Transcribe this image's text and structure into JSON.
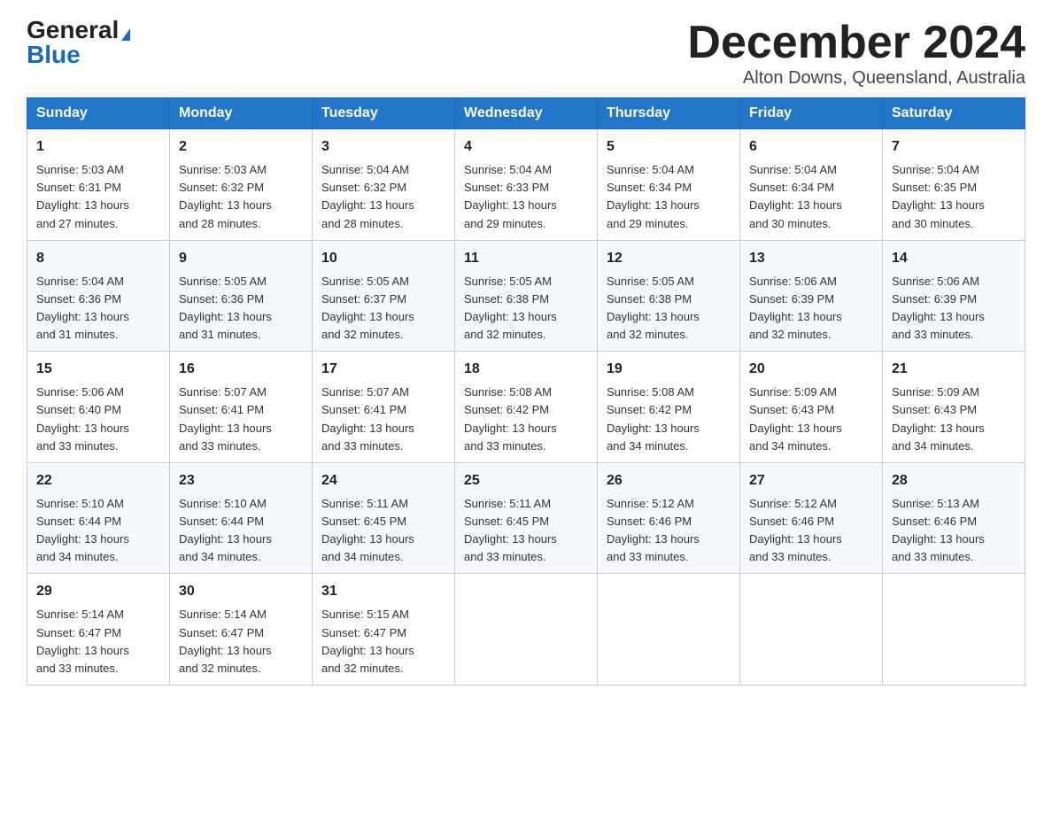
{
  "header": {
    "logo_general": "General",
    "logo_blue": "Blue",
    "month_title": "December 2024",
    "subtitle": "Alton Downs, Queensland, Australia"
  },
  "days_of_week": [
    "Sunday",
    "Monday",
    "Tuesday",
    "Wednesday",
    "Thursday",
    "Friday",
    "Saturday"
  ],
  "weeks": [
    [
      {
        "num": "1",
        "sunrise": "5:03 AM",
        "sunset": "6:31 PM",
        "daylight": "13 hours and 27 minutes."
      },
      {
        "num": "2",
        "sunrise": "5:03 AM",
        "sunset": "6:32 PM",
        "daylight": "13 hours and 28 minutes."
      },
      {
        "num": "3",
        "sunrise": "5:04 AM",
        "sunset": "6:32 PM",
        "daylight": "13 hours and 28 minutes."
      },
      {
        "num": "4",
        "sunrise": "5:04 AM",
        "sunset": "6:33 PM",
        "daylight": "13 hours and 29 minutes."
      },
      {
        "num": "5",
        "sunrise": "5:04 AM",
        "sunset": "6:34 PM",
        "daylight": "13 hours and 29 minutes."
      },
      {
        "num": "6",
        "sunrise": "5:04 AM",
        "sunset": "6:34 PM",
        "daylight": "13 hours and 30 minutes."
      },
      {
        "num": "7",
        "sunrise": "5:04 AM",
        "sunset": "6:35 PM",
        "daylight": "13 hours and 30 minutes."
      }
    ],
    [
      {
        "num": "8",
        "sunrise": "5:04 AM",
        "sunset": "6:36 PM",
        "daylight": "13 hours and 31 minutes."
      },
      {
        "num": "9",
        "sunrise": "5:05 AM",
        "sunset": "6:36 PM",
        "daylight": "13 hours and 31 minutes."
      },
      {
        "num": "10",
        "sunrise": "5:05 AM",
        "sunset": "6:37 PM",
        "daylight": "13 hours and 32 minutes."
      },
      {
        "num": "11",
        "sunrise": "5:05 AM",
        "sunset": "6:38 PM",
        "daylight": "13 hours and 32 minutes."
      },
      {
        "num": "12",
        "sunrise": "5:05 AM",
        "sunset": "6:38 PM",
        "daylight": "13 hours and 32 minutes."
      },
      {
        "num": "13",
        "sunrise": "5:06 AM",
        "sunset": "6:39 PM",
        "daylight": "13 hours and 32 minutes."
      },
      {
        "num": "14",
        "sunrise": "5:06 AM",
        "sunset": "6:39 PM",
        "daylight": "13 hours and 33 minutes."
      }
    ],
    [
      {
        "num": "15",
        "sunrise": "5:06 AM",
        "sunset": "6:40 PM",
        "daylight": "13 hours and 33 minutes."
      },
      {
        "num": "16",
        "sunrise": "5:07 AM",
        "sunset": "6:41 PM",
        "daylight": "13 hours and 33 minutes."
      },
      {
        "num": "17",
        "sunrise": "5:07 AM",
        "sunset": "6:41 PM",
        "daylight": "13 hours and 33 minutes."
      },
      {
        "num": "18",
        "sunrise": "5:08 AM",
        "sunset": "6:42 PM",
        "daylight": "13 hours and 33 minutes."
      },
      {
        "num": "19",
        "sunrise": "5:08 AM",
        "sunset": "6:42 PM",
        "daylight": "13 hours and 34 minutes."
      },
      {
        "num": "20",
        "sunrise": "5:09 AM",
        "sunset": "6:43 PM",
        "daylight": "13 hours and 34 minutes."
      },
      {
        "num": "21",
        "sunrise": "5:09 AM",
        "sunset": "6:43 PM",
        "daylight": "13 hours and 34 minutes."
      }
    ],
    [
      {
        "num": "22",
        "sunrise": "5:10 AM",
        "sunset": "6:44 PM",
        "daylight": "13 hours and 34 minutes."
      },
      {
        "num": "23",
        "sunrise": "5:10 AM",
        "sunset": "6:44 PM",
        "daylight": "13 hours and 34 minutes."
      },
      {
        "num": "24",
        "sunrise": "5:11 AM",
        "sunset": "6:45 PM",
        "daylight": "13 hours and 34 minutes."
      },
      {
        "num": "25",
        "sunrise": "5:11 AM",
        "sunset": "6:45 PM",
        "daylight": "13 hours and 33 minutes."
      },
      {
        "num": "26",
        "sunrise": "5:12 AM",
        "sunset": "6:46 PM",
        "daylight": "13 hours and 33 minutes."
      },
      {
        "num": "27",
        "sunrise": "5:12 AM",
        "sunset": "6:46 PM",
        "daylight": "13 hours and 33 minutes."
      },
      {
        "num": "28",
        "sunrise": "5:13 AM",
        "sunset": "6:46 PM",
        "daylight": "13 hours and 33 minutes."
      }
    ],
    [
      {
        "num": "29",
        "sunrise": "5:14 AM",
        "sunset": "6:47 PM",
        "daylight": "13 hours and 33 minutes."
      },
      {
        "num": "30",
        "sunrise": "5:14 AM",
        "sunset": "6:47 PM",
        "daylight": "13 hours and 32 minutes."
      },
      {
        "num": "31",
        "sunrise": "5:15 AM",
        "sunset": "6:47 PM",
        "daylight": "13 hours and 32 minutes."
      },
      null,
      null,
      null,
      null
    ]
  ],
  "labels": {
    "sunrise": "Sunrise:",
    "sunset": "Sunset:",
    "daylight": "Daylight:"
  }
}
